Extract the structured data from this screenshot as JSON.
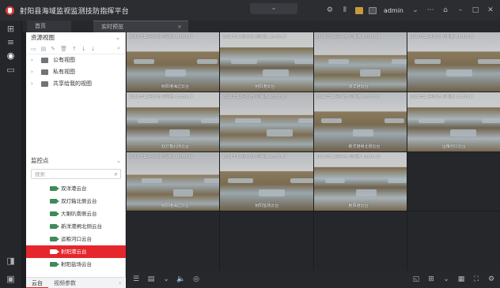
{
  "app": {
    "title": "射阳县海域监视监测技防指挥平台",
    "user": "admin"
  },
  "tabs": [
    {
      "label": "首页"
    },
    {
      "label": "实时预览"
    }
  ],
  "resource_panel": {
    "header": "资源视图",
    "tree": [
      {
        "label": "公有视图"
      },
      {
        "label": "私有视图"
      },
      {
        "label": "共享给我的视图"
      }
    ]
  },
  "monitor_panel": {
    "header": "监控点",
    "search_placeholder": "搜索",
    "cameras": [
      {
        "label": "双洋港云台"
      },
      {
        "label": "双灯箱北侧云台"
      },
      {
        "label": "大喇叭南侧云台"
      },
      {
        "label": "新洋港闸北侧云台"
      },
      {
        "label": "运粮河口云台"
      },
      {
        "label": "射阳港云台",
        "selected": true
      },
      {
        "label": "射阳盐场云台"
      }
    ],
    "tabs": [
      {
        "label": "云台"
      },
      {
        "label": "视频参数"
      }
    ]
  },
  "video_grid": {
    "rows": 4,
    "cols": 4,
    "cells": [
      {
        "ts": "2021年12月09日 星期四 16:56:17",
        "name": "射阳港海边云台",
        "style": "video"
      },
      {
        "ts": "2021年12月09日 星期四 16:56:17",
        "name": "射阳港云台",
        "style": "v2"
      },
      {
        "ts": "2021年12月09日 星期四 16:56:15",
        "name": "双洋港云台",
        "style": "v3"
      },
      {
        "ts": "2021年12月09日 星期四 16:56:18",
        "name": "",
        "style": "video"
      },
      {
        "ts": "2021年12月09日 星期四 16:56:17",
        "name": "双灯箱北侧云台",
        "style": "v2"
      },
      {
        "ts": "2021年12月09日 星期四 16:56:16",
        "name": "",
        "style": "v3"
      },
      {
        "ts": "2021年12月09日 星期四 16:56:17",
        "name": "新洋港闸北侧云台",
        "style": "video"
      },
      {
        "ts": "2021年12月09日 星期四 16:56:17",
        "name": "运粮河口云台",
        "style": "v2"
      },
      {
        "ts": "2021年12月09日 星期四 16:56:17",
        "name": "射阳港海边云台",
        "style": "v3"
      },
      {
        "ts": "2021年12月09日 星期四 16:56:17",
        "name": "射阳盐场云台",
        "style": "video"
      },
      {
        "ts": "2021年12月09日 星期四 16:56:16",
        "name": "射阳港云台",
        "style": "v2"
      }
    ]
  }
}
